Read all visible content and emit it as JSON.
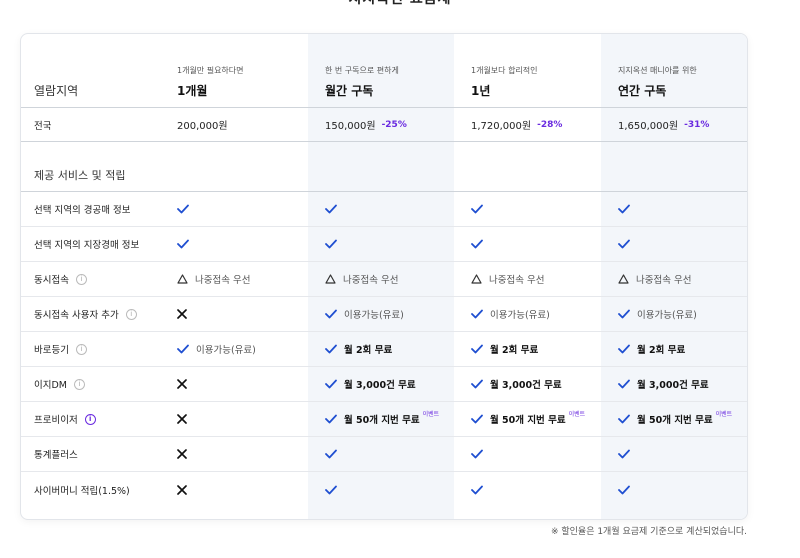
{
  "page_title": "지지옥션 요금제",
  "header": {
    "region_label": "열람지역",
    "plans": [
      {
        "sub": "1개월만 필요하다면",
        "name": "1개월"
      },
      {
        "sub": "한 번 구독으로 편하게",
        "name": "월간 구독"
      },
      {
        "sub": "1개월보다 합리적인",
        "name": "1년"
      },
      {
        "sub": "지지옥션 매니아를 위한",
        "name": "연간 구독"
      }
    ]
  },
  "price_row": {
    "label": "전국",
    "prices": [
      {
        "price": "200,000원",
        "discount": ""
      },
      {
        "price": "150,000원",
        "discount": "-25%"
      },
      {
        "price": "1,720,000원",
        "discount": "-28%"
      },
      {
        "price": "1,650,000원",
        "discount": "-31%"
      }
    ]
  },
  "section_title": "제공 서비스 및 적립",
  "features": [
    {
      "label": "선택 지역의 경공매 정보",
      "values": [
        "check",
        "check",
        "check",
        "check"
      ]
    },
    {
      "label": "선택 지역의 지장경매 정보",
      "values": [
        "check",
        "check",
        "check",
        "check"
      ]
    },
    {
      "label": "동시접속",
      "info": true,
      "values": [
        {
          "icon": "triangle",
          "text": "나중접속 우선"
        },
        {
          "icon": "triangle",
          "text": "나중접속 우선"
        },
        {
          "icon": "triangle",
          "text": "나중접속 우선"
        },
        {
          "icon": "triangle",
          "text": "나중접속 우선"
        }
      ]
    },
    {
      "label": "동시접속 사용자 추가",
      "info": true,
      "values": [
        {
          "icon": "x"
        },
        {
          "icon": "check",
          "text": "이용가능(유료)"
        },
        {
          "icon": "check",
          "text": "이용가능(유료)"
        },
        {
          "icon": "check",
          "text": "이용가능(유료)"
        }
      ]
    },
    {
      "label": "바로등기",
      "info": true,
      "values": [
        {
          "icon": "check",
          "text": "이용가능(유료)"
        },
        {
          "icon": "check",
          "text": "월 2회 무료",
          "bold": true
        },
        {
          "icon": "check",
          "text": "월 2회 무료",
          "bold": true
        },
        {
          "icon": "check",
          "text": "월 2회 무료",
          "bold": true
        }
      ]
    },
    {
      "label": "이지DM",
      "info": true,
      "values": [
        {
          "icon": "x"
        },
        {
          "icon": "check",
          "text": "월 3,000건 무료",
          "bold": true
        },
        {
          "icon": "check",
          "text": "월 3,000건 무료",
          "bold": true
        },
        {
          "icon": "check",
          "text": "월 3,000건 무료",
          "bold": true
        }
      ]
    },
    {
      "label": "프로비이저",
      "info": true,
      "info_purple": true,
      "values": [
        {
          "icon": "x"
        },
        {
          "icon": "check",
          "text": "월 50개 지번 무료",
          "bold": true,
          "badge": "이벤트"
        },
        {
          "icon": "check",
          "text": "월 50개 지번 무료",
          "bold": true,
          "badge": "이벤트"
        },
        {
          "icon": "check",
          "text": "월 50개 지번 무료",
          "bold": true,
          "badge": "이벤트"
        }
      ]
    },
    {
      "label": "통계플러스",
      "values": [
        "x",
        "check",
        "check",
        "check"
      ]
    },
    {
      "label": "사이버머니 적립(1.5%)",
      "values": [
        "x",
        "check",
        "check",
        "check"
      ]
    }
  ],
  "footnote": "※ 할인율은 1개월 요금제 기준으로 계산되었습니다.",
  "colors": {
    "accent": "#6a2be0",
    "highlight_col": "#f3f6fa",
    "check": "#1f4fd1"
  }
}
